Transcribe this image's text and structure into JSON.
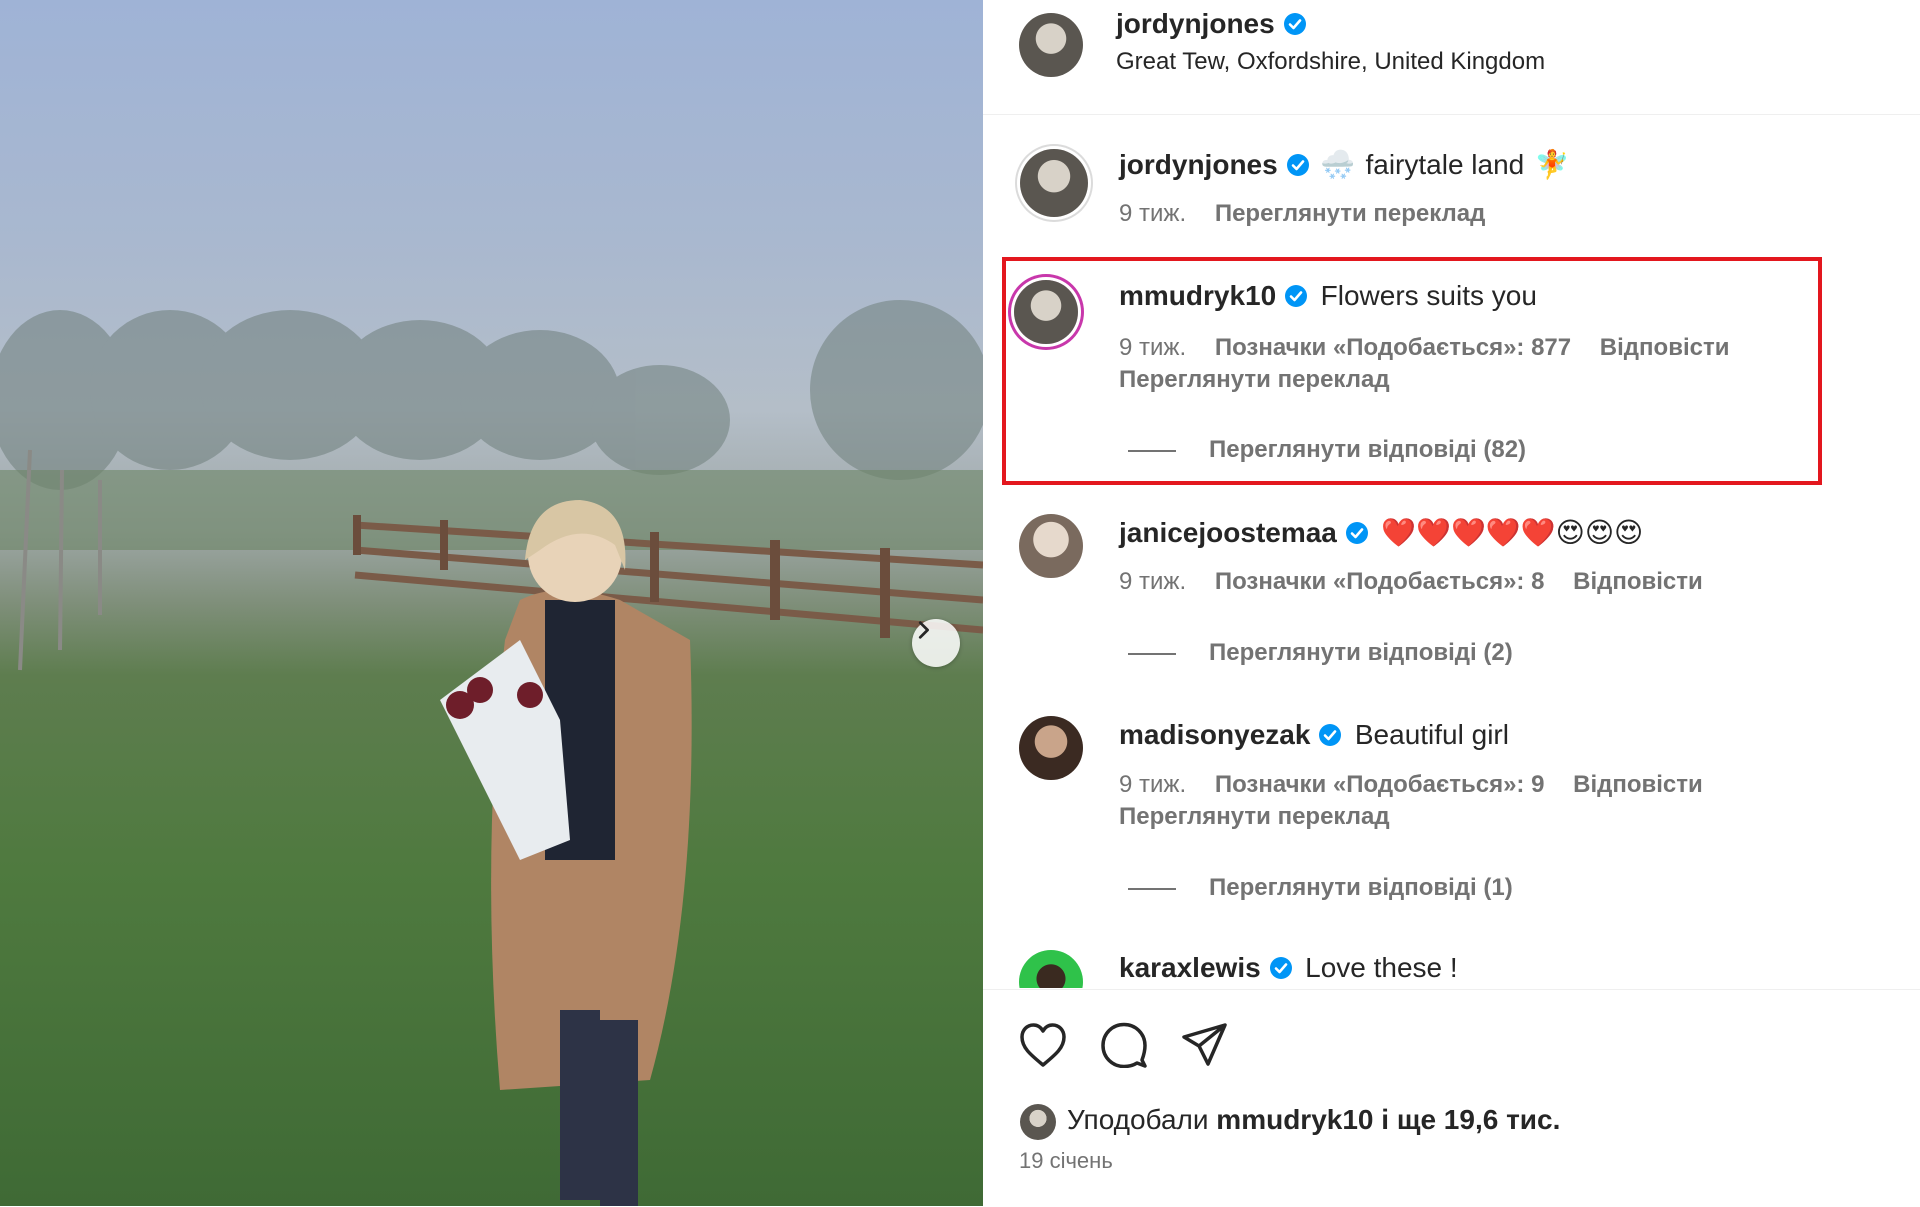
{
  "post": {
    "author": "jordynjones",
    "location": "Great Tew, Oxfordshire, United Kingdom"
  },
  "caption": {
    "username": "jordynjones",
    "emoji_start": "🌨️",
    "text": "fairytale land",
    "emoji_end": "🧚",
    "time": "9 тиж.",
    "translate": "Переглянути переклад"
  },
  "comments": [
    {
      "username": "mmudryk10",
      "text": "Flowers suits you",
      "time": "9 тиж.",
      "likes": "Позначки «Подобається»: 877",
      "reply": "Відповісти",
      "translate": "Переглянути переклад",
      "view_replies": "Переглянути відповіді (82)"
    },
    {
      "username": "janicejoostemaa",
      "text": "❤️❤️❤️❤️❤️😍😍😍",
      "time": "9 тиж.",
      "likes": "Позначки «Подобається»: 8",
      "reply": "Відповісти",
      "view_replies": "Переглянути відповіді (2)"
    },
    {
      "username": "madisonyezak",
      "text": "Beautiful girl",
      "time": "9 тиж.",
      "likes": "Позначки «Подобається»: 9",
      "reply": "Відповісти",
      "translate": "Переглянути переклад",
      "view_replies": "Переглянути відповіді (1)"
    },
    {
      "username": "karaxlewis",
      "text": "Love these !"
    }
  ],
  "footer": {
    "liked_prefix": "Уподобали",
    "liked_user": "mmudryk10",
    "liked_suffix": "і ще 19,6 тис.",
    "date": "19 січень"
  },
  "colors": {
    "verified": "#0095f6",
    "highlight": "#e3171e",
    "secondary_text": "#737373"
  },
  "icons": [
    "verified-icon",
    "heart-icon",
    "comment-icon",
    "share-icon",
    "chevron-right-icon"
  ]
}
